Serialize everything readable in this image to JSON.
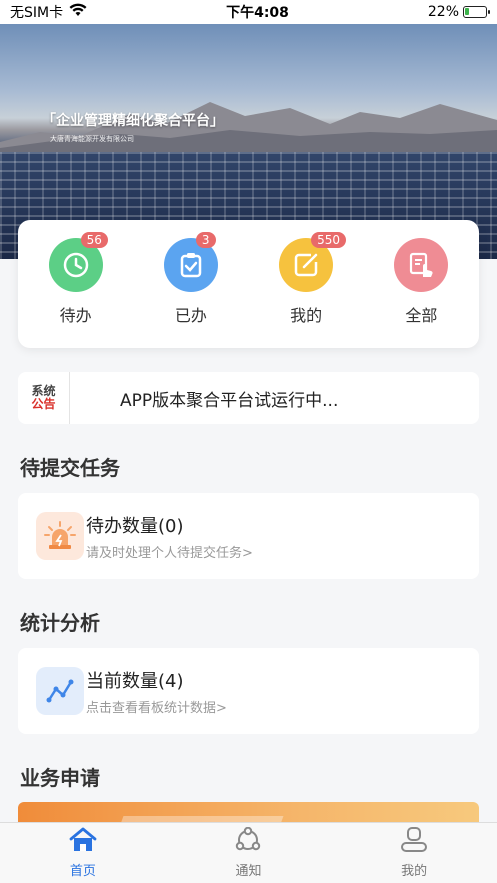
{
  "status_bar": {
    "carrier": "无SIM卡",
    "time": "下午4:08",
    "battery": "22%",
    "battery_level": 0.22
  },
  "banner": {
    "title": "「企业管理精细化聚合平台」",
    "subtitle": "大唐青海能源开发有限公司"
  },
  "quick_actions": [
    {
      "label": "待办",
      "badge": "56",
      "color": "#5ccf86",
      "icon": "clock-check-icon"
    },
    {
      "label": "已办",
      "badge": "3",
      "color": "#5ba4f0",
      "icon": "clipboard-check-icon"
    },
    {
      "label": "我的",
      "badge": "550",
      "color": "#f6c23e",
      "icon": "edit-box-icon"
    },
    {
      "label": "全部",
      "badge": "",
      "color": "#ef8c94",
      "icon": "hand-document-icon"
    }
  ],
  "notice": {
    "logo_line1": "系统",
    "logo_line2": "公告",
    "text": "APP版本聚合平台试运行中..."
  },
  "pending": {
    "section_title": "待提交任务",
    "title": "待办数量(0)",
    "subtitle": "请及时处理个人待提交任务>"
  },
  "stats": {
    "section_title": "统计分析",
    "title": "当前数量(4)",
    "subtitle": "点击查看看板统计数据>"
  },
  "business": {
    "section_title": "业务申请"
  },
  "tabbar": {
    "items": [
      {
        "label": "首页",
        "active": true
      },
      {
        "label": "通知",
        "active": false
      },
      {
        "label": "我的",
        "active": false
      }
    ],
    "accent": "#2a73e0"
  }
}
